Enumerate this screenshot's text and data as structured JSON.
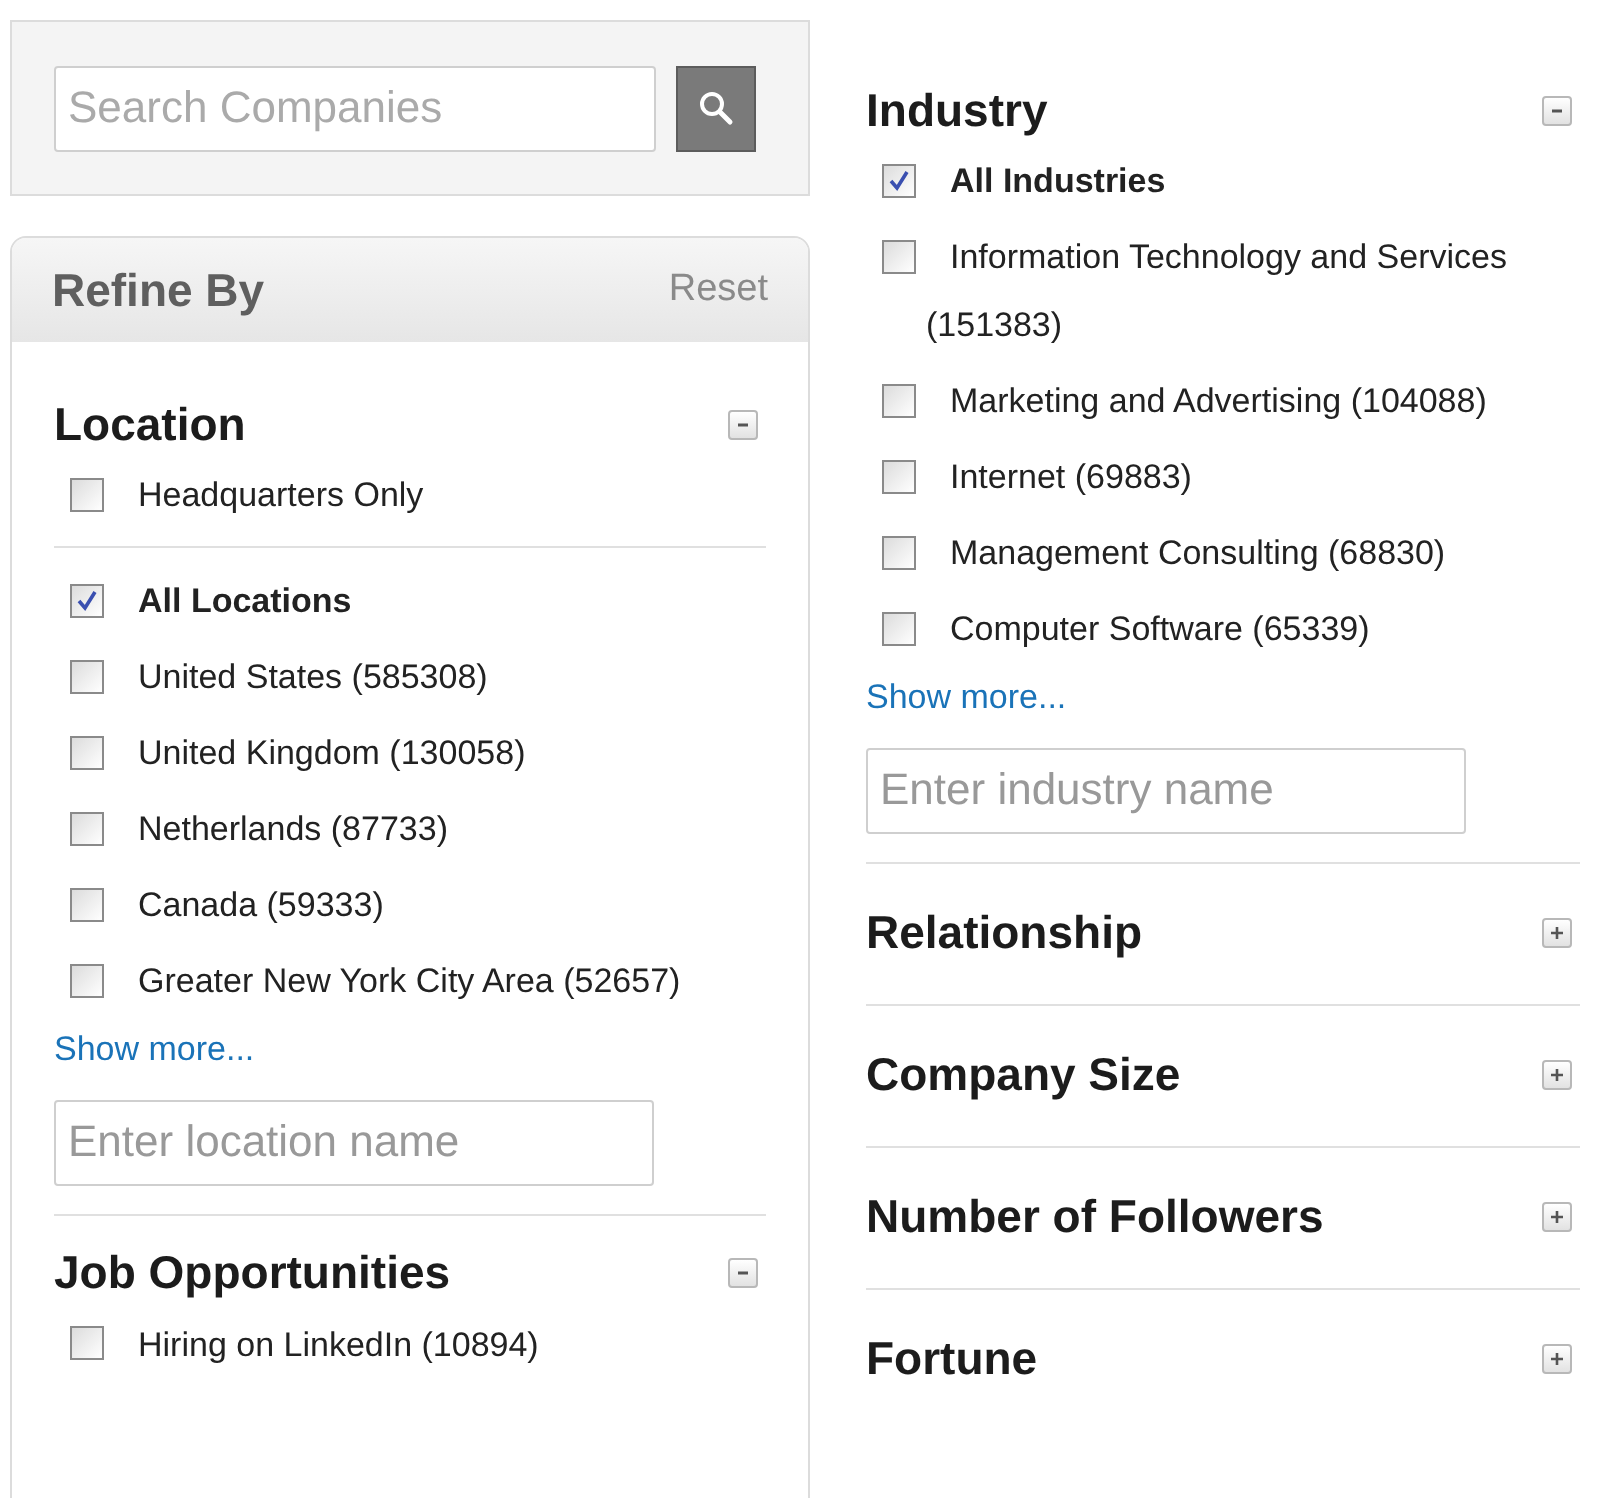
{
  "search": {
    "placeholder": "Search Companies"
  },
  "refine": {
    "title": "Refine By",
    "reset": "Reset"
  },
  "left_sections": [
    {
      "title": "Location",
      "expanded": true,
      "pre_options": [
        {
          "label": "Headquarters Only",
          "checked": false
        }
      ],
      "options": [
        {
          "label": "All Locations",
          "checked": true
        },
        {
          "label": "United States (585308)",
          "checked": false
        },
        {
          "label": "United Kingdom (130058)",
          "checked": false
        },
        {
          "label": "Netherlands (87733)",
          "checked": false
        },
        {
          "label": "Canada (59333)",
          "checked": false
        },
        {
          "label": "Greater New York City Area (52657)",
          "checked": false
        }
      ],
      "show_more": "Show more...",
      "placeholder": "Enter location name"
    },
    {
      "title": "Job Opportunities",
      "expanded": true,
      "options": [
        {
          "label": "Hiring on LinkedIn (10894)",
          "checked": false
        }
      ]
    }
  ],
  "right_sections": [
    {
      "title": "Industry",
      "expanded": true,
      "options": [
        {
          "label": "All Industries",
          "checked": true
        },
        {
          "label": "Information Technology and Services (151383)",
          "checked": false
        },
        {
          "label": "Marketing and Advertising (104088)",
          "checked": false
        },
        {
          "label": "Internet (69883)",
          "checked": false
        },
        {
          "label": "Management Consulting (68830)",
          "checked": false
        },
        {
          "label": "Computer Software (65339)",
          "checked": false
        }
      ],
      "show_more": "Show more...",
      "placeholder": "Enter industry name"
    },
    {
      "title": "Relationship",
      "expanded": false
    },
    {
      "title": "Company Size",
      "expanded": false
    },
    {
      "title": "Number of Followers",
      "expanded": false
    },
    {
      "title": "Fortune",
      "expanded": false
    }
  ]
}
